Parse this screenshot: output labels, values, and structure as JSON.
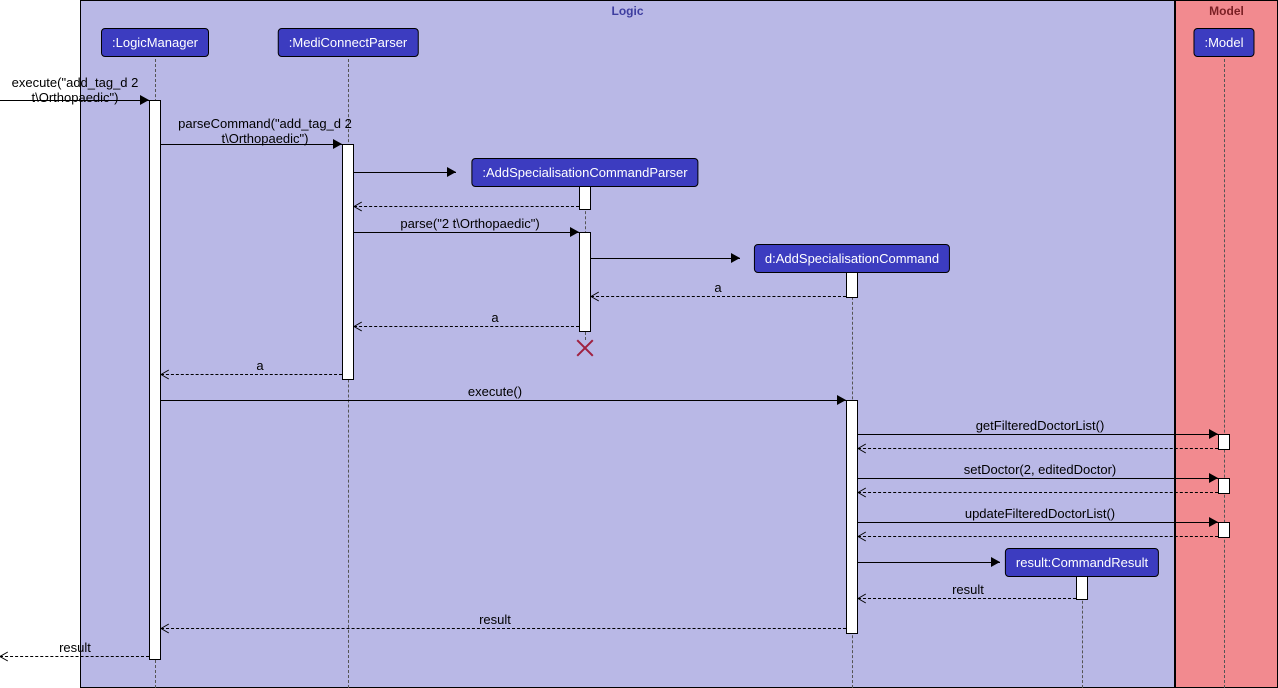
{
  "frames": {
    "logic_title": "Logic",
    "model_title": "Model"
  },
  "participants": {
    "logic_manager": ":LogicManager",
    "mediconnect_parser": ":MediConnectParser",
    "add_spec_parser": ":AddSpecialisationCommandParser",
    "add_spec_command": "d:AddSpecialisationCommand",
    "command_result": "result:CommandResult",
    "model": ":Model"
  },
  "messages": {
    "execute_in": "execute(\"add_tag_d  2 t\\Orthopaedic\")",
    "parse_command": "parseCommand(\"add_tag_d  2 t\\Orthopaedic\")",
    "parse": "parse(\"2 t\\Orthopaedic\")",
    "ret_a1": "a",
    "ret_a2": "a",
    "ret_a3": "a",
    "execute_d": "execute()",
    "get_filtered": "getFilteredDoctorList()",
    "set_doctor": "setDoctor(2, editedDoctor)",
    "update_filtered": "updateFilteredDoctorList()",
    "ret_result1": "result",
    "ret_result2": "result",
    "ret_result_out": "result"
  }
}
